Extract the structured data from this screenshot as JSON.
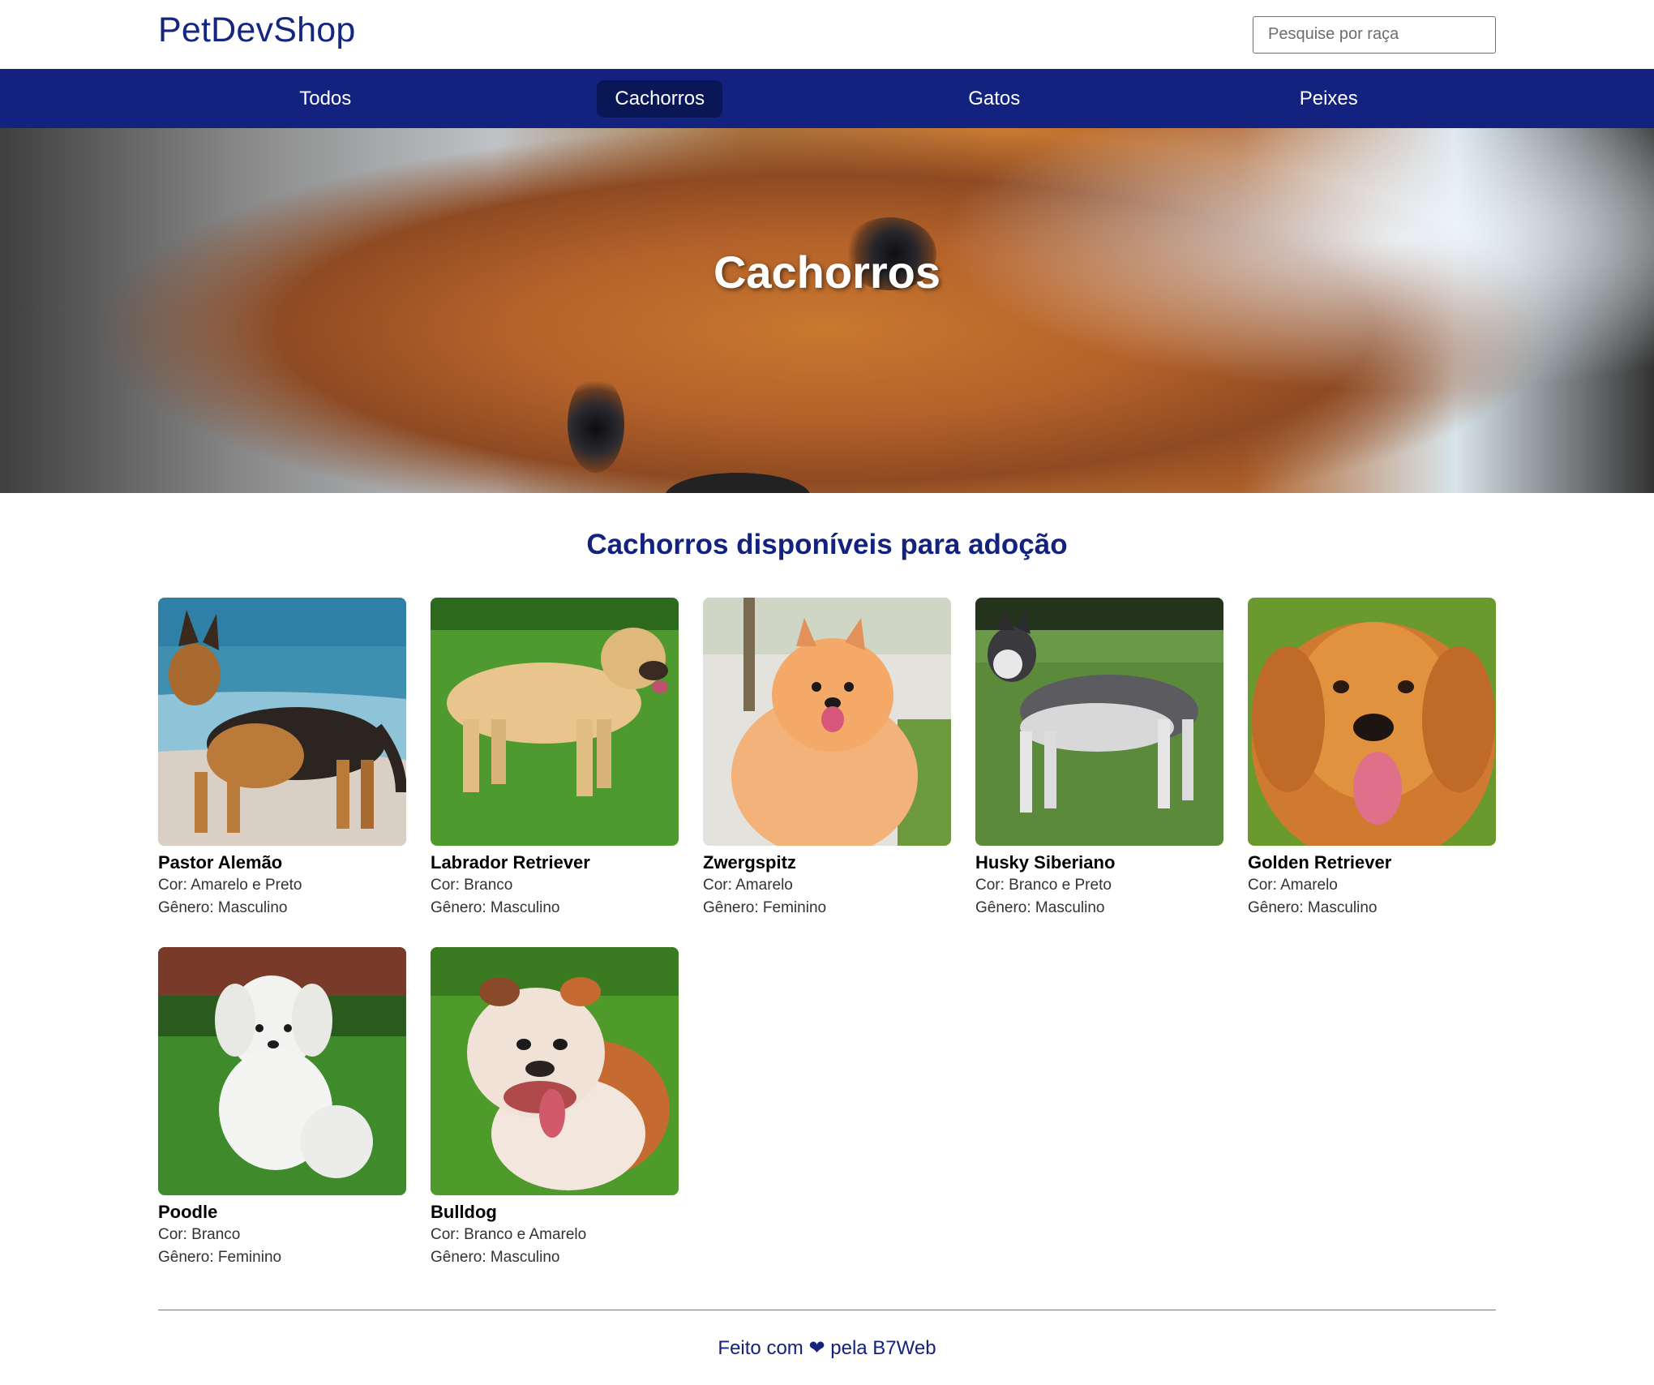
{
  "header": {
    "logo": "PetDevShop",
    "search_placeholder": "Pesquise por raça"
  },
  "nav": {
    "items": [
      {
        "label": "Todos"
      },
      {
        "label": "Cachorros"
      },
      {
        "label": "Gatos"
      },
      {
        "label": "Peixes"
      }
    ],
    "active": "Cachorros"
  },
  "hero": {
    "title": "Cachorros"
  },
  "section": {
    "title": "Cachorros disponíveis para adoção"
  },
  "pets": [
    {
      "name": "Pastor Alemão",
      "color": "Cor: Amarelo e Preto",
      "gender": "Gênero: Masculino"
    },
    {
      "name": "Labrador Retriever",
      "color": "Cor: Branco",
      "gender": "Gênero: Masculino"
    },
    {
      "name": "Zwergspitz",
      "color": "Cor: Amarelo",
      "gender": "Gênero: Feminino"
    },
    {
      "name": "Husky Siberiano",
      "color": "Cor: Branco e Preto",
      "gender": "Gênero: Masculino"
    },
    {
      "name": "Golden Retriever",
      "color": "Cor: Amarelo",
      "gender": "Gênero: Masculino"
    },
    {
      "name": "Poodle",
      "color": "Cor: Branco",
      "gender": "Gênero: Feminino"
    },
    {
      "name": "Bulldog",
      "color": "Cor: Branco e Amarelo",
      "gender": "Gênero: Masculino"
    }
  ],
  "footer": {
    "text_before": "Feito com",
    "heart": "❤",
    "text_after": "pela B7Web"
  },
  "colors": {
    "brand": "#13227f",
    "nav_active": "#0a1756"
  }
}
